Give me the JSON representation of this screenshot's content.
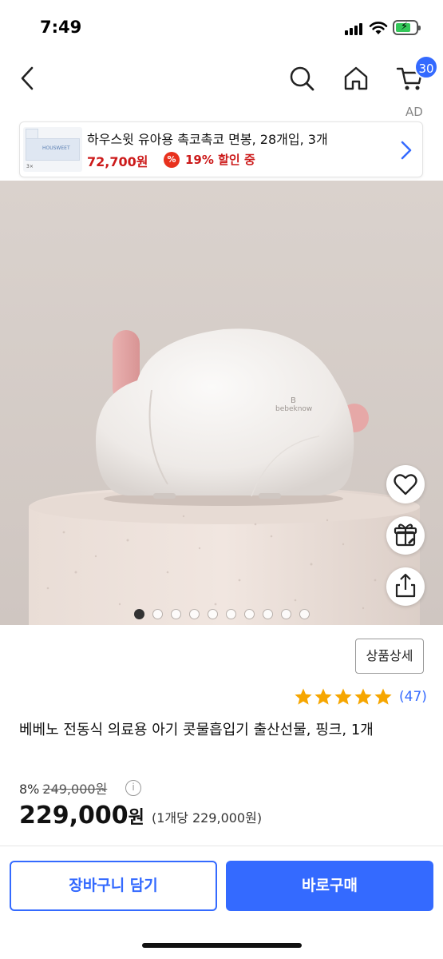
{
  "status_bar": {
    "time": "7:49"
  },
  "nav": {
    "icons": [
      "back-chevron-icon",
      "search-icon",
      "home-icon",
      "cart-icon"
    ],
    "cart_count": "30"
  },
  "ad": {
    "tag": "AD",
    "thumb_brand": "HOUSWEET",
    "thumb_count": "3×",
    "title": "하우스윗 유아용 촉코촉코 면봉, 28개입, 3개",
    "price": "72,700원",
    "discount_icon": "%",
    "discount": "19% 할인 중"
  },
  "product": {
    "image_brand": "bebeknow",
    "image_count": 10,
    "active_image_index": 0,
    "detail_button": "상품상세",
    "rating_stars": 5,
    "review_count": "(47)",
    "title": "베베노 전동식 의료용 아기 콧물흡입기 출산선물, 핑크, 1개",
    "discount_rate": "8%",
    "original_price": "249,000원",
    "price": "229,000",
    "price_unit": "원",
    "unit_price": "(1개당 229,000원)"
  },
  "actions": {
    "add_to_cart": "장바구니 담기",
    "buy_now": "바로구매"
  },
  "colors": {
    "accent": "#346aff",
    "sale_red": "#cc1a1a",
    "star": "#f6a600"
  }
}
